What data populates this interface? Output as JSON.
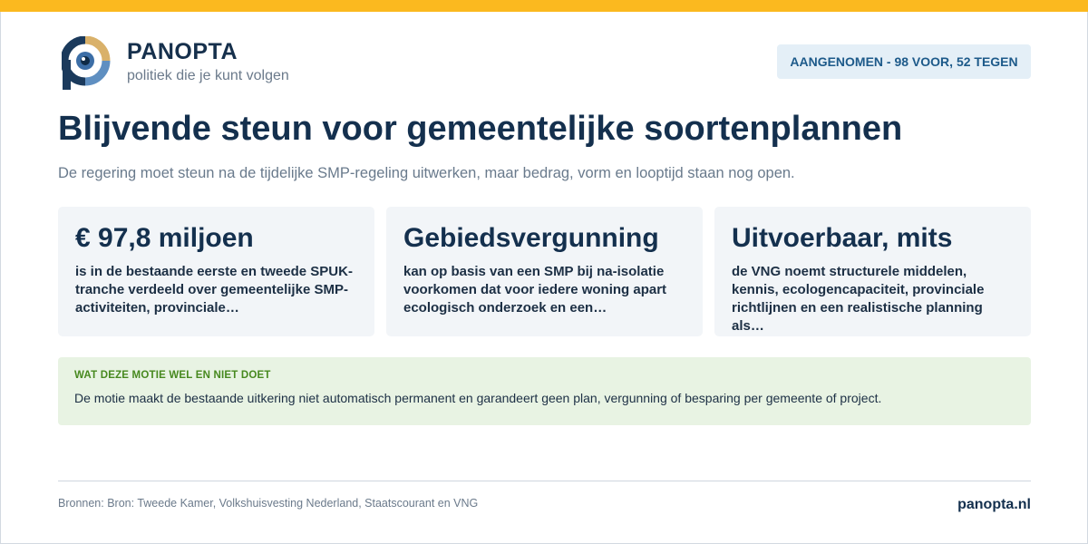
{
  "brand": {
    "name": "PANOPTA",
    "tagline": "politiek die je kunt volgen",
    "accent_color": "#fbb91f",
    "logo_icon": "panopta-eye-logo-icon"
  },
  "status": {
    "label": "AANGENOMEN - 98 VOOR, 52 TEGEN",
    "color": "#1d5a8a"
  },
  "headline": {
    "title": "Blijvende steun voor gemeentelijke soortenplannen",
    "subtitle": "De regering moet steun na de tijdelijke SMP-regeling uitwerken, maar bedrag, vorm en looptijd staan nog open."
  },
  "cards": [
    {
      "title": "€ 97,8 miljoen",
      "body": "is in de bestaande eerste en tweede SPUK-tranche verdeeld over gemeentelijke SMP-activiteiten, provinciale…"
    },
    {
      "title": "Gebiedsvergunning",
      "body": "kan op basis van een SMP bij na-isolatie voorkomen dat voor iedere woning apart ecologisch onderzoek en een…"
    },
    {
      "title": "Uitvoerbaar, mits",
      "body": "de VNG noemt structurele middelen, kennis, ecologencapaciteit, provinciale richtlijnen en een realistische planning als…"
    }
  ],
  "note": {
    "heading": "WAT DEZE MOTIE WEL EN NIET DOET",
    "text": "De motie maakt de bestaande uitkering niet automatisch permanent en garandeert geen plan, vergunning of besparing per gemeente of project."
  },
  "footer": {
    "sources": "Bronnen: Bron: Tweede Kamer, Volkshuisvesting Nederland, Staatscourant en VNG",
    "site": "panopta.nl"
  }
}
